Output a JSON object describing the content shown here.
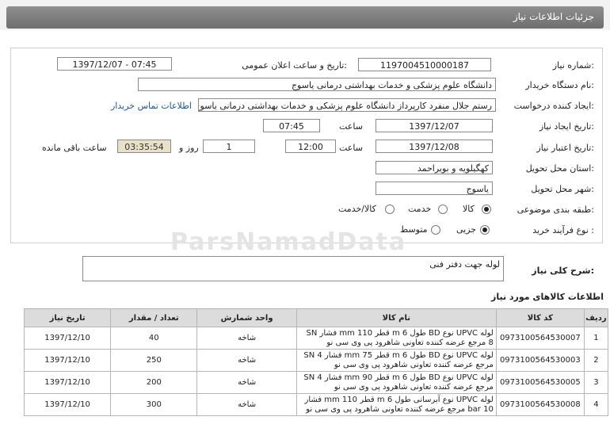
{
  "header": {
    "title": "جزئیات اطلاعات نیاز"
  },
  "form": {
    "need_number_label": "شماره نیاز:",
    "need_number": "1197004510000187",
    "announce_label": "تاریخ و ساعت اعلان عمومی:",
    "announce_value": "1397/12/07 - 07:45",
    "buyer_label": "نام دستگاه خریدار:",
    "buyer": "دانشگاه علوم پزشکی و خدمات بهداشتی درمانی یاسوج",
    "creator_label": "ایجاد کننده درخواست:",
    "creator": "رستم جلال منفرد کارپرداز دانشگاه علوم پزشکی و خدمات بهداشتی درمانی یاسوج",
    "contact_link": "اطلاعات تماس خریدار",
    "created_label": "تاریخ ایجاد نیاز:",
    "created_date": "1397/12/07",
    "time_label": "ساعت",
    "created_time": "07:45",
    "validity_label": "تاریخ اعتبار نیاز:",
    "validity_date": "1397/12/08",
    "validity_time": "12:00",
    "days": "1",
    "day_and": "روز و",
    "remaining": "03:35:54",
    "remaining_label": "ساعت باقی مانده",
    "province_label": "استان محل تحویل:",
    "province": "کهگیلویه و بویراحمد",
    "city_label": "شهر محل تحویل:",
    "city": "یاسوج",
    "category_label": "طبقه بندی موضوعی:",
    "category_options": [
      "کالا",
      "خدمت",
      "کالا/خدمت"
    ],
    "process_label": "نوع فرآیند خرید :",
    "process_options": [
      "جزیی",
      "متوسط"
    ]
  },
  "watermark": "ParsNamadData",
  "description": {
    "label": "شرح کلی نیاز:",
    "value": "لوله جهت دفتر فنی"
  },
  "items_title": "اطلاعات کالاهای مورد نیاز",
  "table": {
    "headers": [
      "ردیف",
      "کد کالا",
      "نام کالا",
      "واحد شمارش",
      "تعداد / مقدار",
      "تاریخ نیاز"
    ],
    "rows": [
      [
        "1",
        "0973100564530007",
        "لوله UPVC نوع BD طول 6 m قطر 110 mm فشار SN 8 مرجع عرضه کننده تعاونی شاهرود پی وی سی نو",
        "شاخه",
        "40",
        "1397/12/10"
      ],
      [
        "2",
        "0973100564530003",
        "لوله UPVC نوع BD طول 6 m قطر 75 mm فشار SN 4 مرجع عرضه کننده تعاونی شاهرود پی وی سی نو",
        "شاخه",
        "250",
        "1397/12/10"
      ],
      [
        "3",
        "0973100564530005",
        "لوله UPVC نوع BD طول 6 m قطر 90 mm فشار SN 4 مرجع عرضه کننده تعاونی شاهرود پی وی سی نو",
        "شاخه",
        "200",
        "1397/12/10"
      ],
      [
        "4",
        "0973100564530008",
        "لوله UPVC نوع آبرسانی طول 6 m قطر 110 mm فشار 10 bar مرجع عرضه کننده تعاونی شاهرود پی وی سی نو",
        "شاخه",
        "300",
        "1397/12/10"
      ]
    ]
  }
}
